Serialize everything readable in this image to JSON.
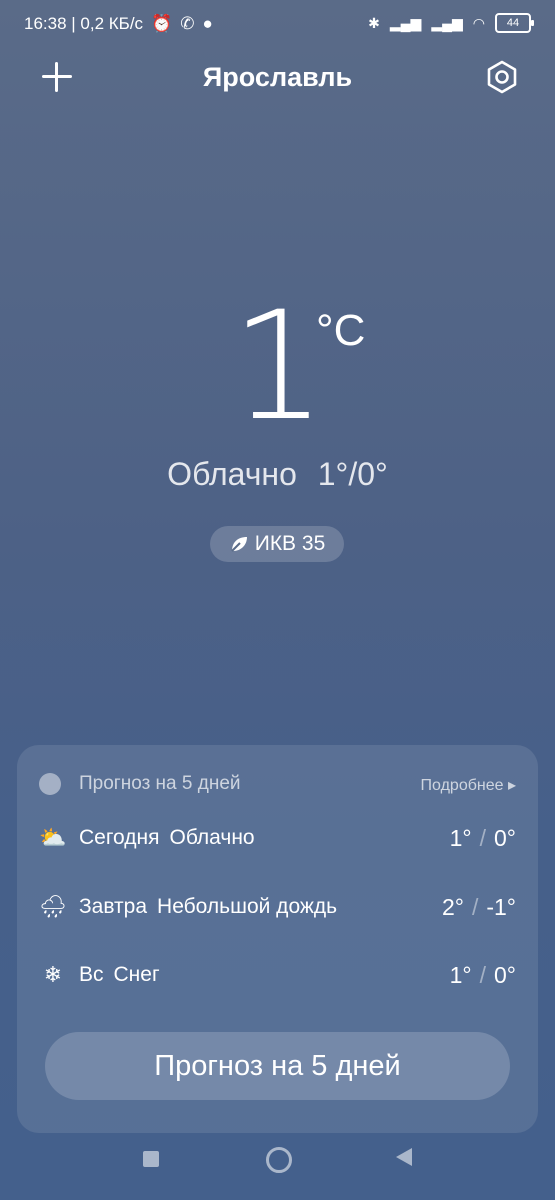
{
  "status_bar": {
    "time_data": "16:38 | 0,2 КБ/с",
    "battery": "44"
  },
  "top_bar": {
    "city": "Ярославль"
  },
  "current": {
    "temperature": "1",
    "unit": "°C",
    "condition": "Облачно",
    "range": "1°/0°",
    "aqi_label": "ИКВ 35"
  },
  "forecast_card": {
    "title": "Прогноз на 5 дней",
    "more_label": "Подробнее ▸",
    "days": [
      {
        "day": "Сегодня",
        "condition": "Облачно",
        "high": "1°",
        "low": "0°",
        "icon": "cloudy-sun-icon"
      },
      {
        "day": "Завтра",
        "condition": "Небольшой дождь",
        "high": "2°",
        "low": "-1°",
        "icon": "rain-cloud-icon"
      },
      {
        "day": "Вс",
        "condition": "Снег",
        "high": "1°",
        "low": "0°",
        "icon": "snowflake-icon"
      }
    ],
    "button_label": "Прогноз на 5 дней"
  }
}
